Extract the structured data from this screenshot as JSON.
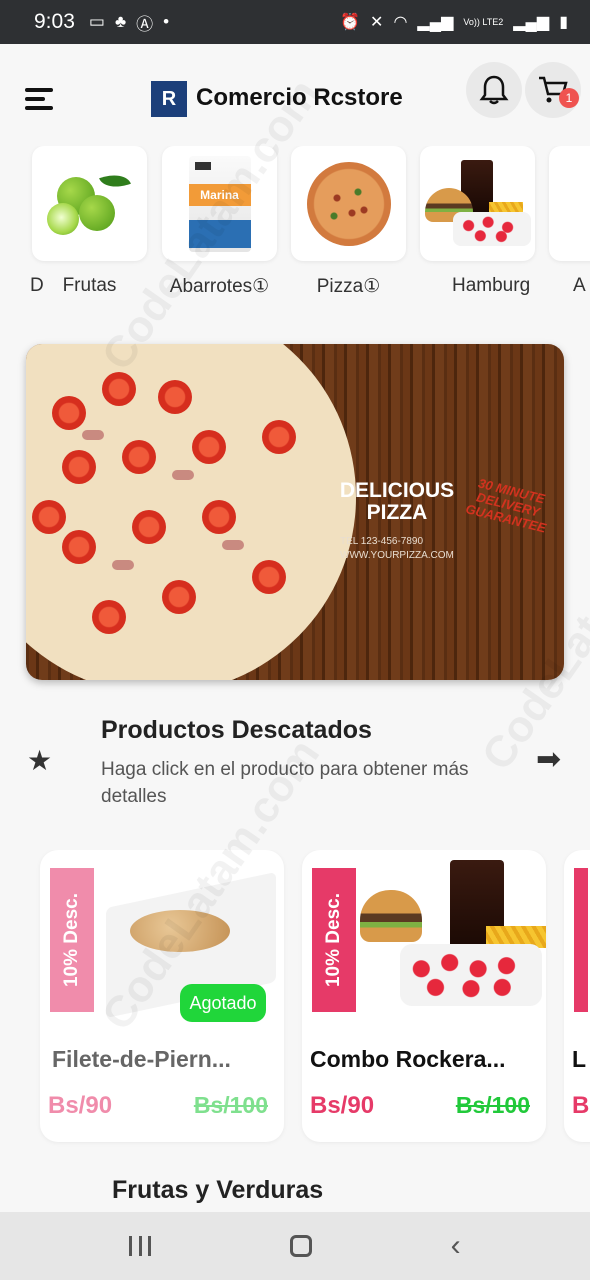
{
  "status_bar": {
    "time": "9:03",
    "network": "Vo)) LTE2"
  },
  "header": {
    "brand": "Comercio Rcstore",
    "cart_badge": "1",
    "icons": [
      "menu-icon",
      "logo",
      "bell-icon",
      "cart-icon"
    ]
  },
  "categories": [
    {
      "label": "D",
      "partial": true
    },
    {
      "label": "Frutas",
      "image": "limes"
    },
    {
      "label": "Abarrotes①",
      "image": "salt-pack",
      "pack_text": "Marina"
    },
    {
      "label": "Pizza①",
      "image": "pizza"
    },
    {
      "label": "Hamburg",
      "image": "burger-combo"
    },
    {
      "label": "A",
      "partial": true
    }
  ],
  "banner": {
    "title": "DELICIOUS PIZZA",
    "tel": "TEL 123-456-7890",
    "web": "WWW.YOURPIZZA.COM",
    "delivery": "30 MINUTE DELIVERY GUARANTEE"
  },
  "featured": {
    "title": "Productos Descatados",
    "subtitle": "Haga click en el producto para obtener más detalles"
  },
  "products": [
    {
      "discount": "10% Desc.",
      "name": "Filete-de-Piern...",
      "price": "Bs/90",
      "old_price": "Bs/100",
      "sold_out": "Agotado",
      "available": false
    },
    {
      "discount": "10% Desc.",
      "name": "Combo Rockera...",
      "price": "Bs/90",
      "old_price": "Bs/100",
      "available": true
    },
    {
      "name": "L",
      "price": "B",
      "partial": true
    }
  ],
  "section2": {
    "title": "Frutas y Verduras"
  },
  "colors": {
    "accent_pink": "#e63a68",
    "faded_pink": "#f08cab",
    "green_price": "#21c93a",
    "sold_badge": "#20d63a",
    "cart_badge": "#ef5350",
    "statusbar": "#2e3033"
  },
  "watermark": "CodeLatam.com"
}
